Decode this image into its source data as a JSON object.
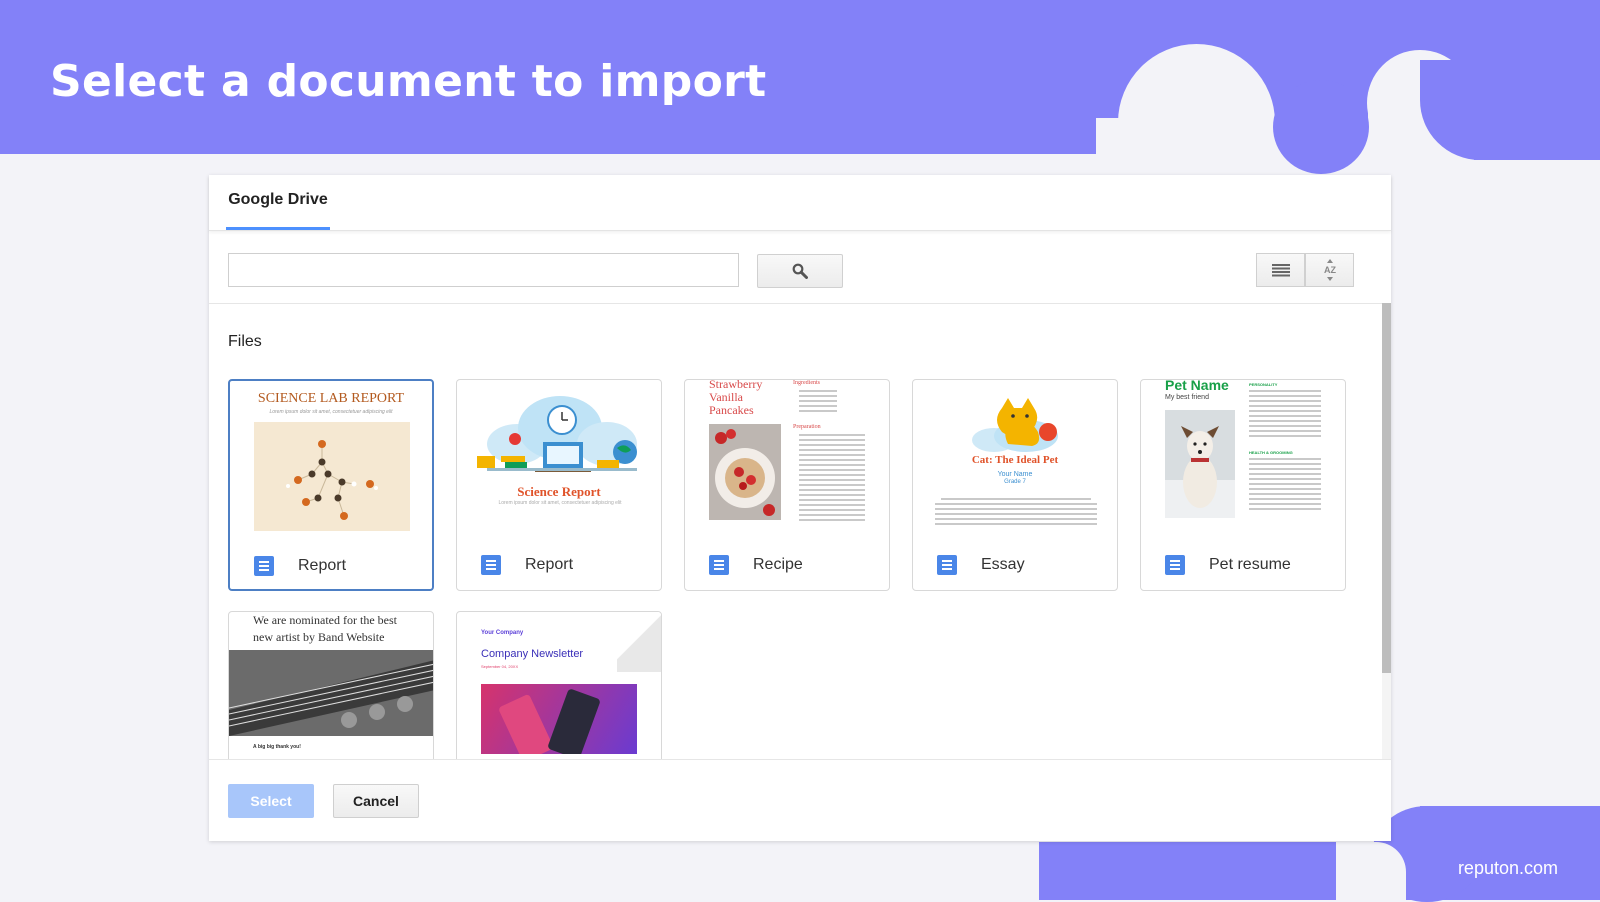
{
  "hero": {
    "title": "Select a document to import"
  },
  "brand": "reputon.com",
  "dialog": {
    "tab_label": "Google Drive",
    "search": {
      "value": "",
      "placeholder": ""
    },
    "section_label": "Files",
    "files": [
      {
        "name": "Report",
        "thumb": {
          "title": "SCIENCE LAB REPORT",
          "subtitle": "Lorem ipsum dolor sit amet, consectetuer adipiscing elit"
        },
        "icon": "google-docs-icon",
        "selected": true
      },
      {
        "name": "Report",
        "thumb": {
          "title": "Science Report",
          "subtitle": "Lorem ipsum dolor sit amet, consectetuer adipiscing elit"
        },
        "icon": "google-docs-icon"
      },
      {
        "name": "Recipe",
        "thumb": {
          "title": "Strawberry Vanilla Pancakes",
          "section1": "Ingredients",
          "section2": "Preparation"
        },
        "icon": "google-docs-icon"
      },
      {
        "name": "Essay",
        "thumb": {
          "title": "Cat: The Ideal Pet",
          "subtitle": "Your Name",
          "grade": "Grade 7"
        },
        "icon": "google-docs-icon"
      },
      {
        "name": "Pet resume",
        "thumb": {
          "title": "Pet Name",
          "subtitle": "My best friend",
          "section1": "PERSONALITY",
          "section2": "HEALTH & GROOMING"
        },
        "icon": "google-docs-icon"
      },
      {
        "name": "",
        "thumb": {
          "title": "We are nominated for the best new artist by Band Website",
          "caption": "A big big thank you!"
        }
      },
      {
        "name": "",
        "thumb": {
          "company": "Your Company",
          "title": "Company Newsletter",
          "date": "September 04, 20XX"
        }
      }
    ],
    "actions": {
      "select_label": "Select",
      "cancel_label": "Cancel"
    }
  },
  "colors": {
    "banner": "#8381f8",
    "accent": "#4d90fe",
    "doc_icon": "#4a86e8",
    "select_disabled": "#a8c6fa"
  }
}
